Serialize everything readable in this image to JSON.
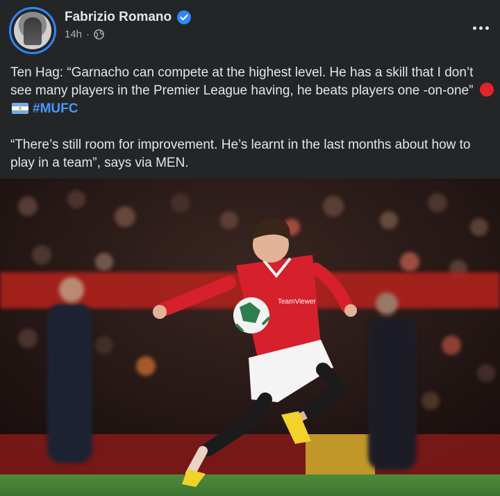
{
  "post": {
    "author": "Fabrizio Romano",
    "time": "14h",
    "separator": "·",
    "text_para1_prefix": "Ten Hag: “Garnacho can compete at the highest level. He has a skill that I don’t see many players in the Premier League having, he beats players one -on-one”",
    "hashtag": "#MUFC",
    "text_para2": "“There’s still room for improvement. He’s learnt in the last months about how to play in a team”, says via MEN."
  },
  "icons": {
    "verified": "verified-badge-icon",
    "audience": "globe-icon",
    "more": "more-options-icon",
    "emoji1": "red-circle-emoji",
    "emoji2": "argentina-flag-emoji"
  },
  "colors": {
    "background": "#242526",
    "text": "#e4e6eb",
    "secondary_text": "#b0b3b8",
    "hashtag": "#4599ff",
    "verified": "#2d88ff",
    "kit_red": "#d6202b"
  },
  "photo": {
    "kit_sponsor": "TeamViewer"
  }
}
